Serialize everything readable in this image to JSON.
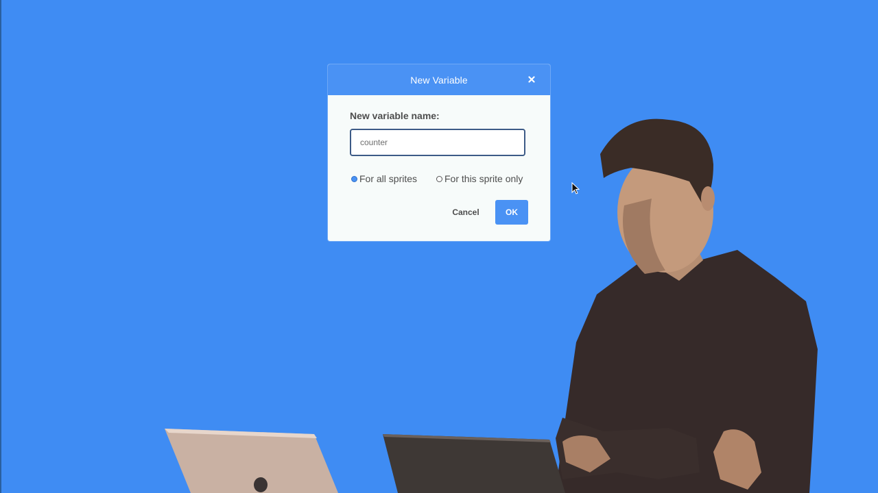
{
  "dialog": {
    "title": "New Variable",
    "close_icon": "close-icon",
    "field_label": "New variable name:",
    "name_input": {
      "value": "counter",
      "placeholder": ""
    },
    "scope_options": [
      {
        "label": "For all sprites",
        "selected": true
      },
      {
        "label": "For this sprite only",
        "selected": false
      }
    ],
    "cancel_label": "Cancel",
    "ok_label": "OK"
  },
  "colors": {
    "background": "#3f8cf3",
    "dialog_header": "#4a92f4",
    "dialog_body": "#f7fbfa",
    "input_border": "#3c5a86",
    "ok_button": "#4a92f4",
    "label_text": "#4d4d4d"
  },
  "scene": {
    "cursor_icon": "mouse-pointer-icon",
    "presenter": "presenter-figure",
    "laptops": [
      "laptop-left",
      "laptop-right"
    ]
  }
}
